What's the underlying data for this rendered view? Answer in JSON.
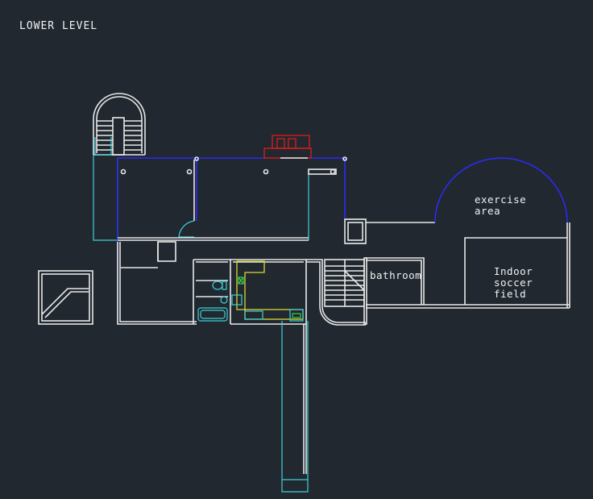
{
  "drawing": {
    "title": "LOWER LEVEL",
    "rooms": {
      "exercise": [
        "exercise",
        "area"
      ],
      "bathroom": "bathroom",
      "soccer": [
        "Indoor",
        "soccer",
        "field"
      ]
    }
  },
  "colors": {
    "background": "#212830",
    "walls": "#e8e8e8",
    "cyan": "#3fd0d6",
    "blue": "#2c2cf0",
    "red": "#d21c1c",
    "yellow": "#d8d832",
    "green": "#36d04a"
  }
}
